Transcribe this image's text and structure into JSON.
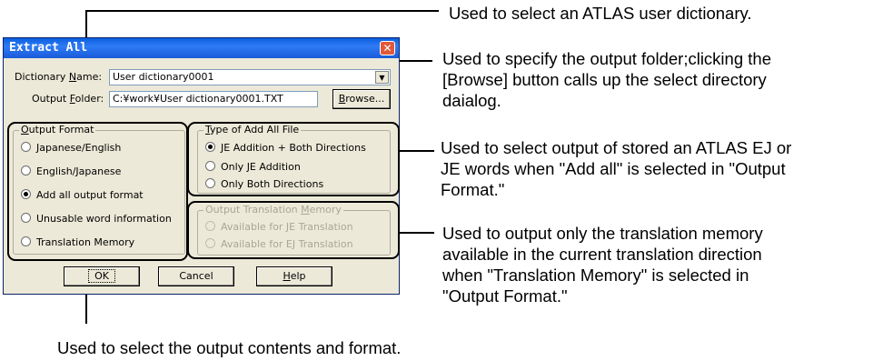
{
  "annotations": {
    "dictionary_note": "Used to select an ATLAS user dictionary.",
    "folder_note_1": "Used to specify the output folder;clicking the",
    "folder_note_2": "[Browse] button calls up the select directory",
    "folder_note_3": "daialog.",
    "type_note_1": "Used to select output of stored an ATLAS EJ or",
    "type_note_2": "JE words when \"Add all\" is selected in \"Output",
    "type_note_3": "Format.\"",
    "tm_note_1": "Used to output only the translation memory",
    "tm_note_2": "available in the current translation direction",
    "tm_note_3": "when \"Translation Memory\" is selected in",
    "tm_note_4": "\"Output Format.\"",
    "format_note": "Used to select the output contents and format."
  },
  "dialog": {
    "title": "Extract All",
    "dictionary_label_pre": "Dictionary ",
    "dictionary_label_u": "N",
    "dictionary_label_post": "ame:",
    "dictionary_value": "User dictionary0001",
    "folder_label_pre": "Output ",
    "folder_label_u": "F",
    "folder_label_post": "older:",
    "folder_value": "C:¥work¥User dictionary0001.TXT",
    "browse_u": "B",
    "browse_rest": "rowse...",
    "output_format": {
      "title_u": "O",
      "title_rest": "utput Format",
      "options": [
        "Japanese/English",
        "English/Japanese",
        "Add all output format",
        "Unusable word information",
        "Translation Memory"
      ],
      "selected": "Add all output format"
    },
    "type_add_all": {
      "title_u": "T",
      "title_rest": "ype of Add All File",
      "options": [
        "JE Addition + Both Directions",
        "Only JE Addition",
        "Only Both Directions"
      ],
      "selected": "JE Addition + Both Directions"
    },
    "output_tm": {
      "title_pre": "Output Translation ",
      "title_u": "M",
      "title_rest": "emory",
      "options": [
        "Available for JE Translation",
        "Available for EJ Translation"
      ]
    },
    "ok_label": "OK",
    "cancel_label": "Cancel",
    "help_u": "H",
    "help_rest": "elp"
  }
}
